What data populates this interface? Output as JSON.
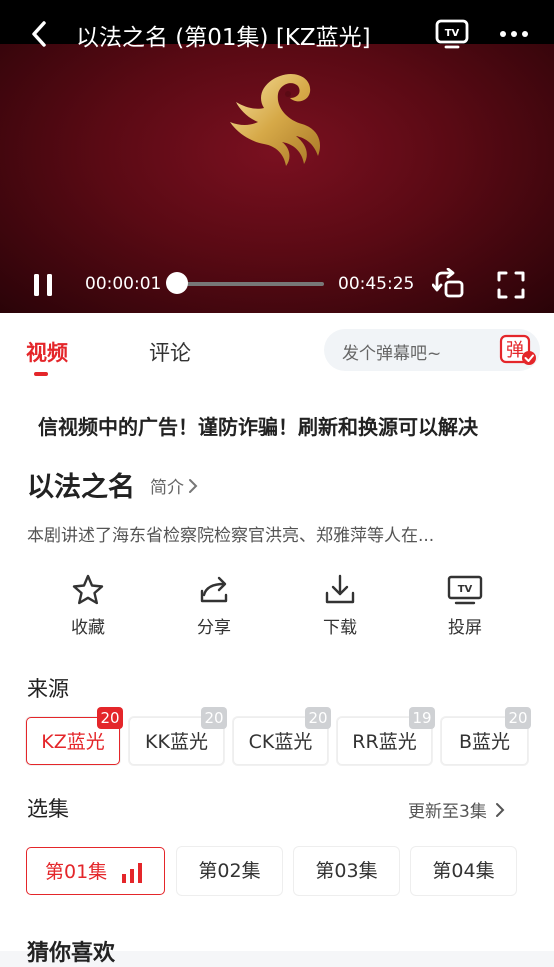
{
  "player": {
    "title": "以法之名 (第01集) [KZ蓝光]",
    "current_time": "00:00:01",
    "total_time": "00:45:25",
    "progress": 0.0004
  },
  "tabs": [
    {
      "label": "视频",
      "active": true
    },
    {
      "label": "评论",
      "active": false
    }
  ],
  "danmu": {
    "placeholder": "发个弹幕吧~",
    "button_label": "弹"
  },
  "notice": "信视频中的广告！谨防诈骗！刷新和换源可以解决",
  "show": {
    "title": "以法之名",
    "intro_label": "简介",
    "description": "本剧讲述了海东省检察院检察官洪亮、郑雅萍等人在..."
  },
  "actions": [
    {
      "label": "收藏",
      "icon": "star-icon"
    },
    {
      "label": "分享",
      "icon": "share-icon"
    },
    {
      "label": "下载",
      "icon": "download-icon"
    },
    {
      "label": "投屏",
      "icon": "tv-cast-icon"
    }
  ],
  "sources_title": "来源",
  "sources": [
    {
      "label": "KZ蓝光",
      "count": "20",
      "active": true
    },
    {
      "label": "KK蓝光",
      "count": "20",
      "active": false
    },
    {
      "label": "CK蓝光",
      "count": "20",
      "active": false
    },
    {
      "label": "RR蓝光",
      "count": "19",
      "active": false
    },
    {
      "label": "B蓝光",
      "count": "20",
      "active": false
    }
  ],
  "episodes_title": "选集",
  "update_status": "更新至3集",
  "episodes": [
    {
      "label": "第01集",
      "active": true
    },
    {
      "label": "第02集",
      "active": false
    },
    {
      "label": "第03集",
      "active": false
    },
    {
      "label": "第04集",
      "active": false
    }
  ],
  "guess_title": "猜你喜欢",
  "colors": {
    "accent": "#e4262a",
    "video_bg": "#5a0a14"
  }
}
